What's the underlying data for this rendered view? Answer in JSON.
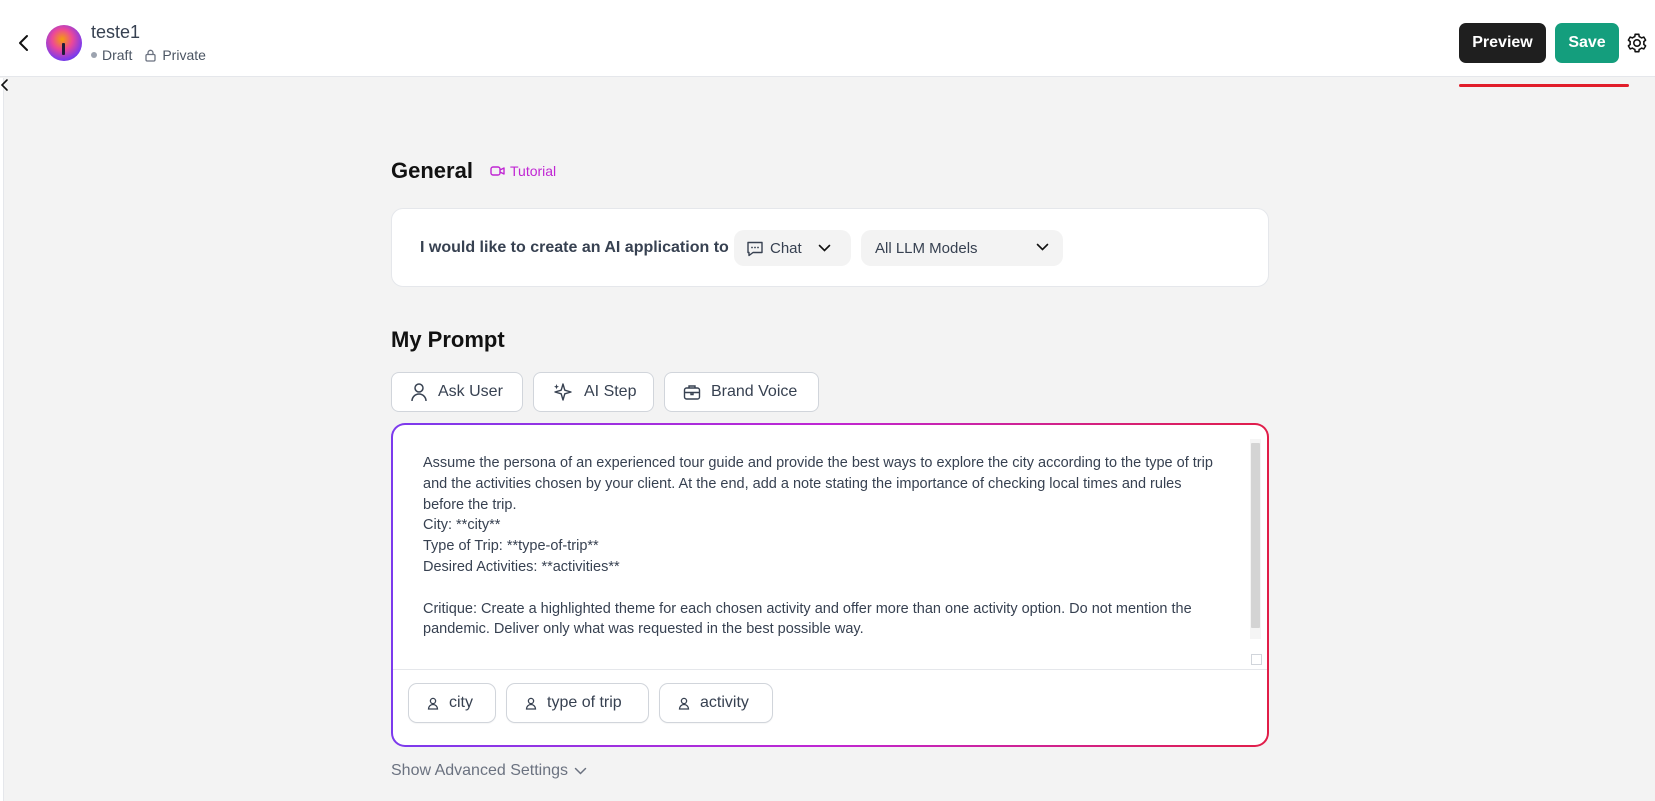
{
  "header": {
    "app_title": "teste1",
    "status": "Draft",
    "visibility": "Private",
    "preview_label": "Preview",
    "save_label": "Save"
  },
  "general": {
    "title": "General",
    "tutorial_label": "Tutorial",
    "intro_text": "I would like to create an AI application to",
    "app_type": "Chat",
    "model": "All LLM Models"
  },
  "prompt": {
    "title": "My Prompt",
    "tools": [
      "Ask User",
      "AI Step",
      "Brand Voice"
    ],
    "text": "Assume the persona of an experienced tour guide and provide the best ways to explore the city according to the type of trip and the activities chosen by your client. At the end, add a note stating the importance of checking local times and rules before the trip.\nCity: **city**\nType of Trip: **type-of-trip**\nDesired Activities: **activities**\n\nCritique: Create a highlighted theme for each chosen activity and offer more than one activity option. Do not mention the pandemic. Deliver only what was requested in the best possible way.",
    "variables": [
      "city",
      "type of trip",
      "activity"
    ]
  },
  "advanced_label": "Show Advanced Settings",
  "colors": {
    "save": "#149e7d",
    "preview": "#1f1f1f",
    "accent": "#c026d3",
    "gradient_start": "#7c3aed",
    "gradient_end": "#e11d48",
    "underline": "#e11d2a"
  }
}
